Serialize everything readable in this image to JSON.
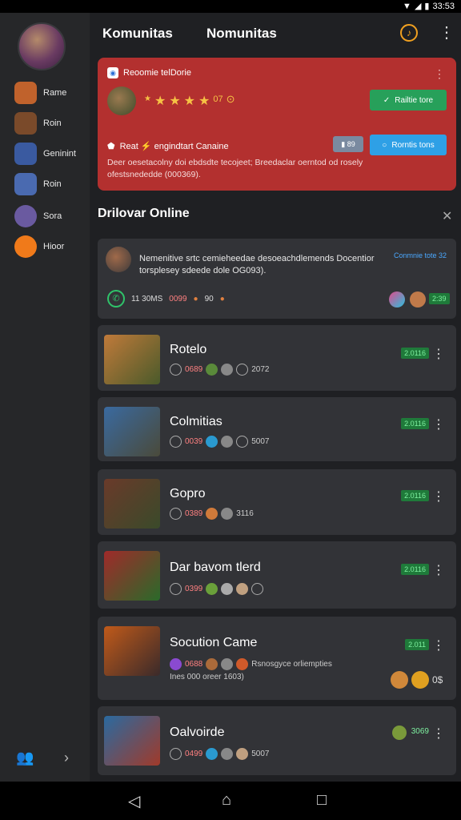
{
  "status": {
    "time": "33:53"
  },
  "header": {
    "title1": "Komunitas",
    "title2": "Nomunitas"
  },
  "sidebar": {
    "items": [
      {
        "label": "Rame",
        "color": "#c0622c"
      },
      {
        "label": "Roin",
        "color": "#7a4a2a"
      },
      {
        "label": "Geninint",
        "color": "#3a5aa0"
      },
      {
        "label": "Roin",
        "color": "#4a6ab0"
      },
      {
        "label": "Sora",
        "color": "#6a5aa0"
      },
      {
        "label": "Hioor",
        "color": "#f07a1a"
      }
    ]
  },
  "promo": {
    "title": "Reoomie telDorie",
    "rating_tail": "07",
    "primary_button": "Railtie tore",
    "secondary_button": "Rorntis tons",
    "subtitle": "Reat ⚡ engindtart Canaine",
    "tag": "89",
    "description": "Deer oesetacolny doi ebdsdte tecojeet; Breedaclar oerntod od rosely ofestsnededde (000369)."
  },
  "section": {
    "title": "Drilovar Online"
  },
  "notice": {
    "text": "Nemenitive srtc cemieheedae desoeachdlemends Docentior torsplesey sdeede dole OG093).",
    "link": "Conmnie tote 32",
    "stats": [
      "11 30MS",
      "0099",
      "90"
    ],
    "badge": "2:39"
  },
  "games": [
    {
      "name": "Rotelo",
      "meta1": "0689",
      "meta2": "2072",
      "badge": "2.0116",
      "colors": [
        "#c07a3a",
        "#4a5a2a"
      ]
    },
    {
      "name": "Colmitias",
      "meta1": "0039",
      "meta2": "5007",
      "badge": "2.0116",
      "colors": [
        "#3a6aa0",
        "#4a4a3a"
      ]
    },
    {
      "name": "Gopro",
      "meta1": "0389",
      "meta2": "3116",
      "badge": "2.0116",
      "colors": [
        "#6a3a2a",
        "#3a4a2a"
      ]
    },
    {
      "name": "Dar bavom tlerd",
      "meta1": "0399",
      "meta2": "",
      "badge": "2.0116",
      "colors": [
        "#a02a2a",
        "#2a6a2a"
      ]
    },
    {
      "name": "Socution Came",
      "meta1": "0688",
      "meta2": "Rsnosgyce orliempties",
      "extra": "Ines 000 oreer 1603)",
      "badge": "2.011",
      "tail": "0$",
      "colors": [
        "#c05a1a",
        "#3a2a2a"
      ]
    },
    {
      "name": "Oalvoirde",
      "meta1": "0499",
      "meta2": "5007",
      "badge": "3069",
      "colors": [
        "#2a6aa0",
        "#a03a2a"
      ]
    }
  ]
}
